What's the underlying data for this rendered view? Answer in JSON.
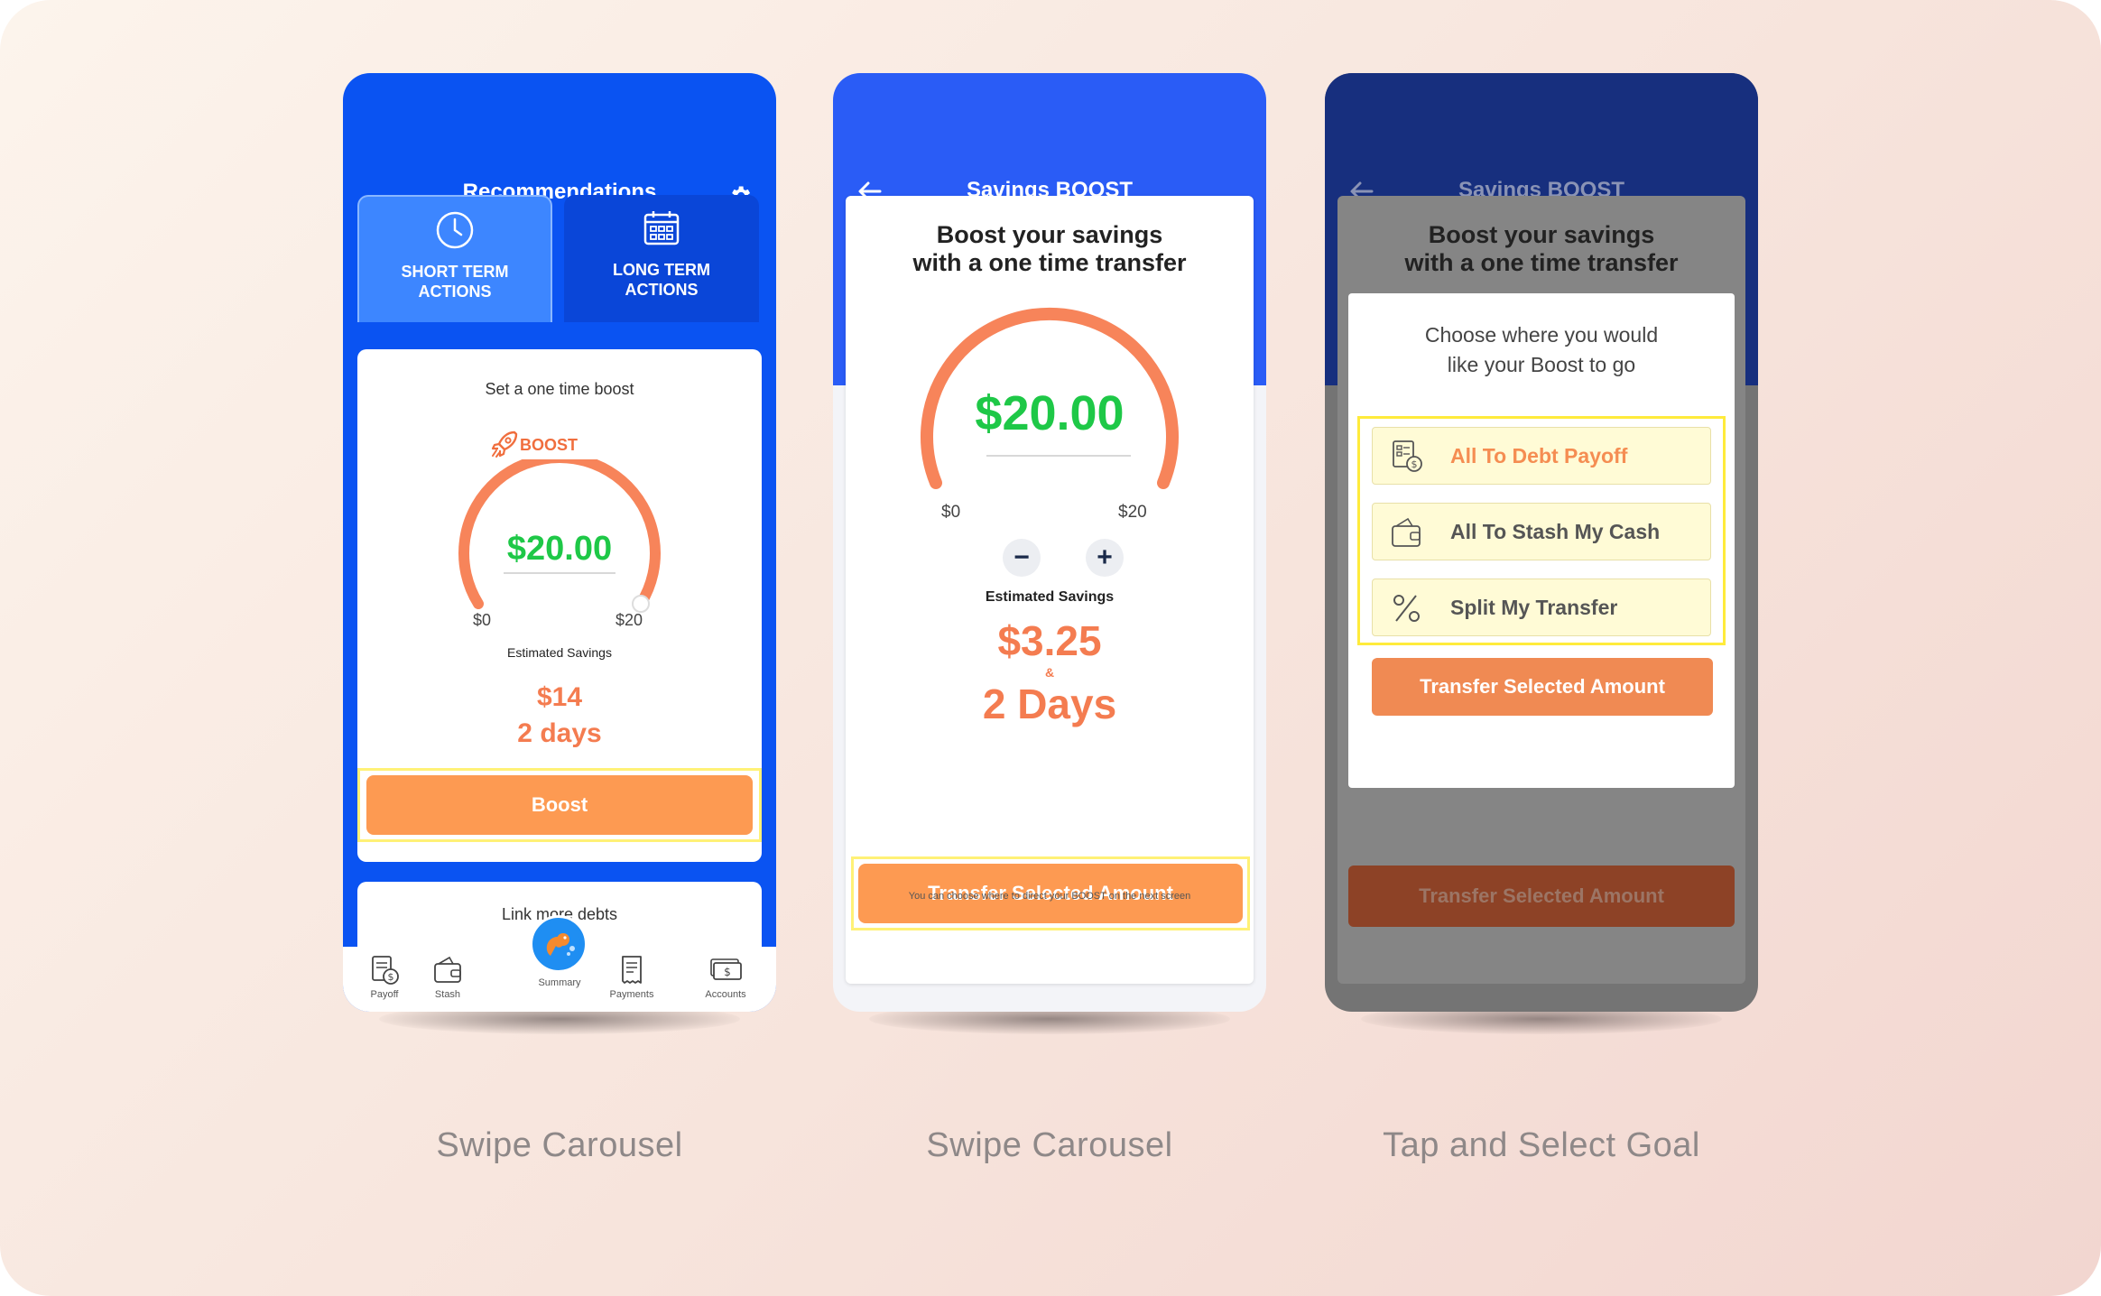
{
  "screens": [
    {
      "title": "Recommendations",
      "tabs": [
        {
          "label": "SHORT TERM ACTIONS",
          "icon": "clock-icon"
        },
        {
          "label": "LONG TERM ACTIONS",
          "icon": "calendar-icon"
        }
      ],
      "card": {
        "title": "Set a one time boost",
        "tag": "BOOST",
        "amount": "$20.00",
        "min_label": "$0",
        "max_label": "$20",
        "estimate_label": "Estimated Savings",
        "estimate_value": "$14",
        "estimate_days": "2 days",
        "button": "Boost"
      },
      "next_card_title": "Link more debts",
      "nav": [
        {
          "label": "Payoff",
          "icon": "payoff-icon"
        },
        {
          "label": "Stash",
          "icon": "wallet-icon"
        },
        {
          "label": "Summary",
          "icon": "squirrel-logo-icon"
        },
        {
          "label": "Payments",
          "icon": "receipt-icon"
        },
        {
          "label": "Accounts",
          "icon": "cash-icon"
        }
      ],
      "caption": "Swipe Carousel"
    },
    {
      "title": "Savings BOOST",
      "heading_line1": "Boost your savings",
      "heading_line2": "with a one time transfer",
      "amount": "$20.00",
      "min_label": "$0",
      "max_label": "$20",
      "decrement": "−",
      "increment": "+",
      "estimate_label": "Estimated Savings",
      "estimate_value": "$3.25",
      "amp": "&",
      "estimate_days": "2 Days",
      "button": "Transfer Selected Amount",
      "note": "You can choose where to direct your BOOST on the next screen",
      "caption": "Swipe Carousel"
    },
    {
      "title": "Savings BOOST",
      "heading_line1": "Boost your savings",
      "heading_line2": "with a one time transfer",
      "modal_line1": "Choose where you would",
      "modal_line2": "like your Boost to go",
      "options": [
        {
          "label": "All To Debt Payoff",
          "icon": "debt-payoff-icon",
          "color": "#f58d52"
        },
        {
          "label": "All To Stash My Cash",
          "icon": "wallet-icon",
          "color": "#555555"
        },
        {
          "label": "Split My Transfer",
          "icon": "percent-icon",
          "color": "#555555"
        }
      ],
      "modal_button": "Transfer Selected Amount",
      "bottom_button": "Transfer Selected Amount",
      "caption": "Tap and Select Goal"
    }
  ],
  "colors": {
    "brand_blue": "#0a53f2",
    "accent_orange": "#fd9a52",
    "value_green": "#1ec847",
    "highlight_yellow": "#fff176"
  },
  "gauge_fill": 1.0
}
